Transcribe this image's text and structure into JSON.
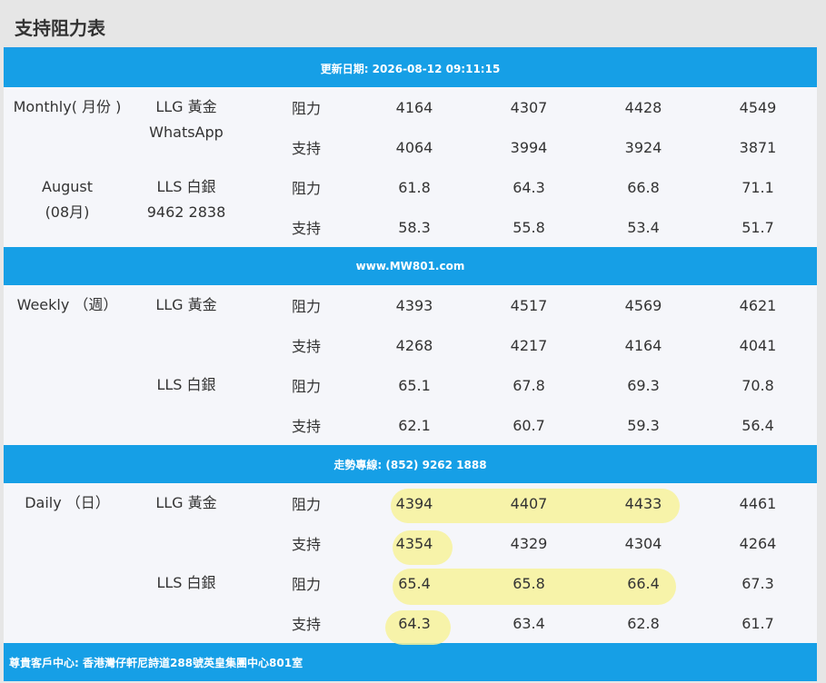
{
  "page_title": "支持阻力表",
  "header_band": "更新日期: 2026-08-12 09:11:15",
  "band_website": "www.MW801.com",
  "band_hotline": "走勢專線: (852) 9262 1888",
  "band_footer": "尊貴客戶中心: 香港灣仔軒尼詩道288號英皇集團中心801室",
  "types": {
    "resistance": "阻力",
    "support": "支持"
  },
  "monthly": {
    "period_line1": "Monthly( 月份 )",
    "period_line2": "August",
    "period_line3": "(08月)",
    "gold_label": "LLG 黃金",
    "gold_sub": "WhatsApp",
    "silver_label": "LLS 白銀",
    "silver_sub": "9462 2838",
    "gold_res": [
      "4164",
      "4307",
      "4428",
      "4549"
    ],
    "gold_sup": [
      "4064",
      "3994",
      "3924",
      "3871"
    ],
    "silver_res": [
      "61.8",
      "64.3",
      "66.8",
      "71.1"
    ],
    "silver_sup": [
      "58.3",
      "55.8",
      "53.4",
      "51.7"
    ]
  },
  "weekly": {
    "period": "Weekly （週）",
    "gold_label": "LLG 黃金",
    "silver_label": "LLS 白銀",
    "gold_res": [
      "4393",
      "4517",
      "4569",
      "4621"
    ],
    "gold_sup": [
      "4268",
      "4217",
      "4164",
      "4041"
    ],
    "silver_res": [
      "65.1",
      "67.8",
      "69.3",
      "70.8"
    ],
    "silver_sup": [
      "62.1",
      "60.7",
      "59.3",
      "56.4"
    ]
  },
  "daily": {
    "period": "Daily （日）",
    "gold_label": "LLG 黃金",
    "silver_label": "LLS 白銀",
    "gold_res": [
      "4394",
      "4407",
      "4433",
      "4461"
    ],
    "gold_sup": [
      "4354",
      "4329",
      "4304",
      "4264"
    ],
    "silver_res": [
      "65.4",
      "65.8",
      "66.4",
      "67.3"
    ],
    "silver_sup": [
      "64.3",
      "63.4",
      "62.8",
      "61.7"
    ]
  },
  "highlight_color": "#f7f29a",
  "band_color": "#169fe6"
}
